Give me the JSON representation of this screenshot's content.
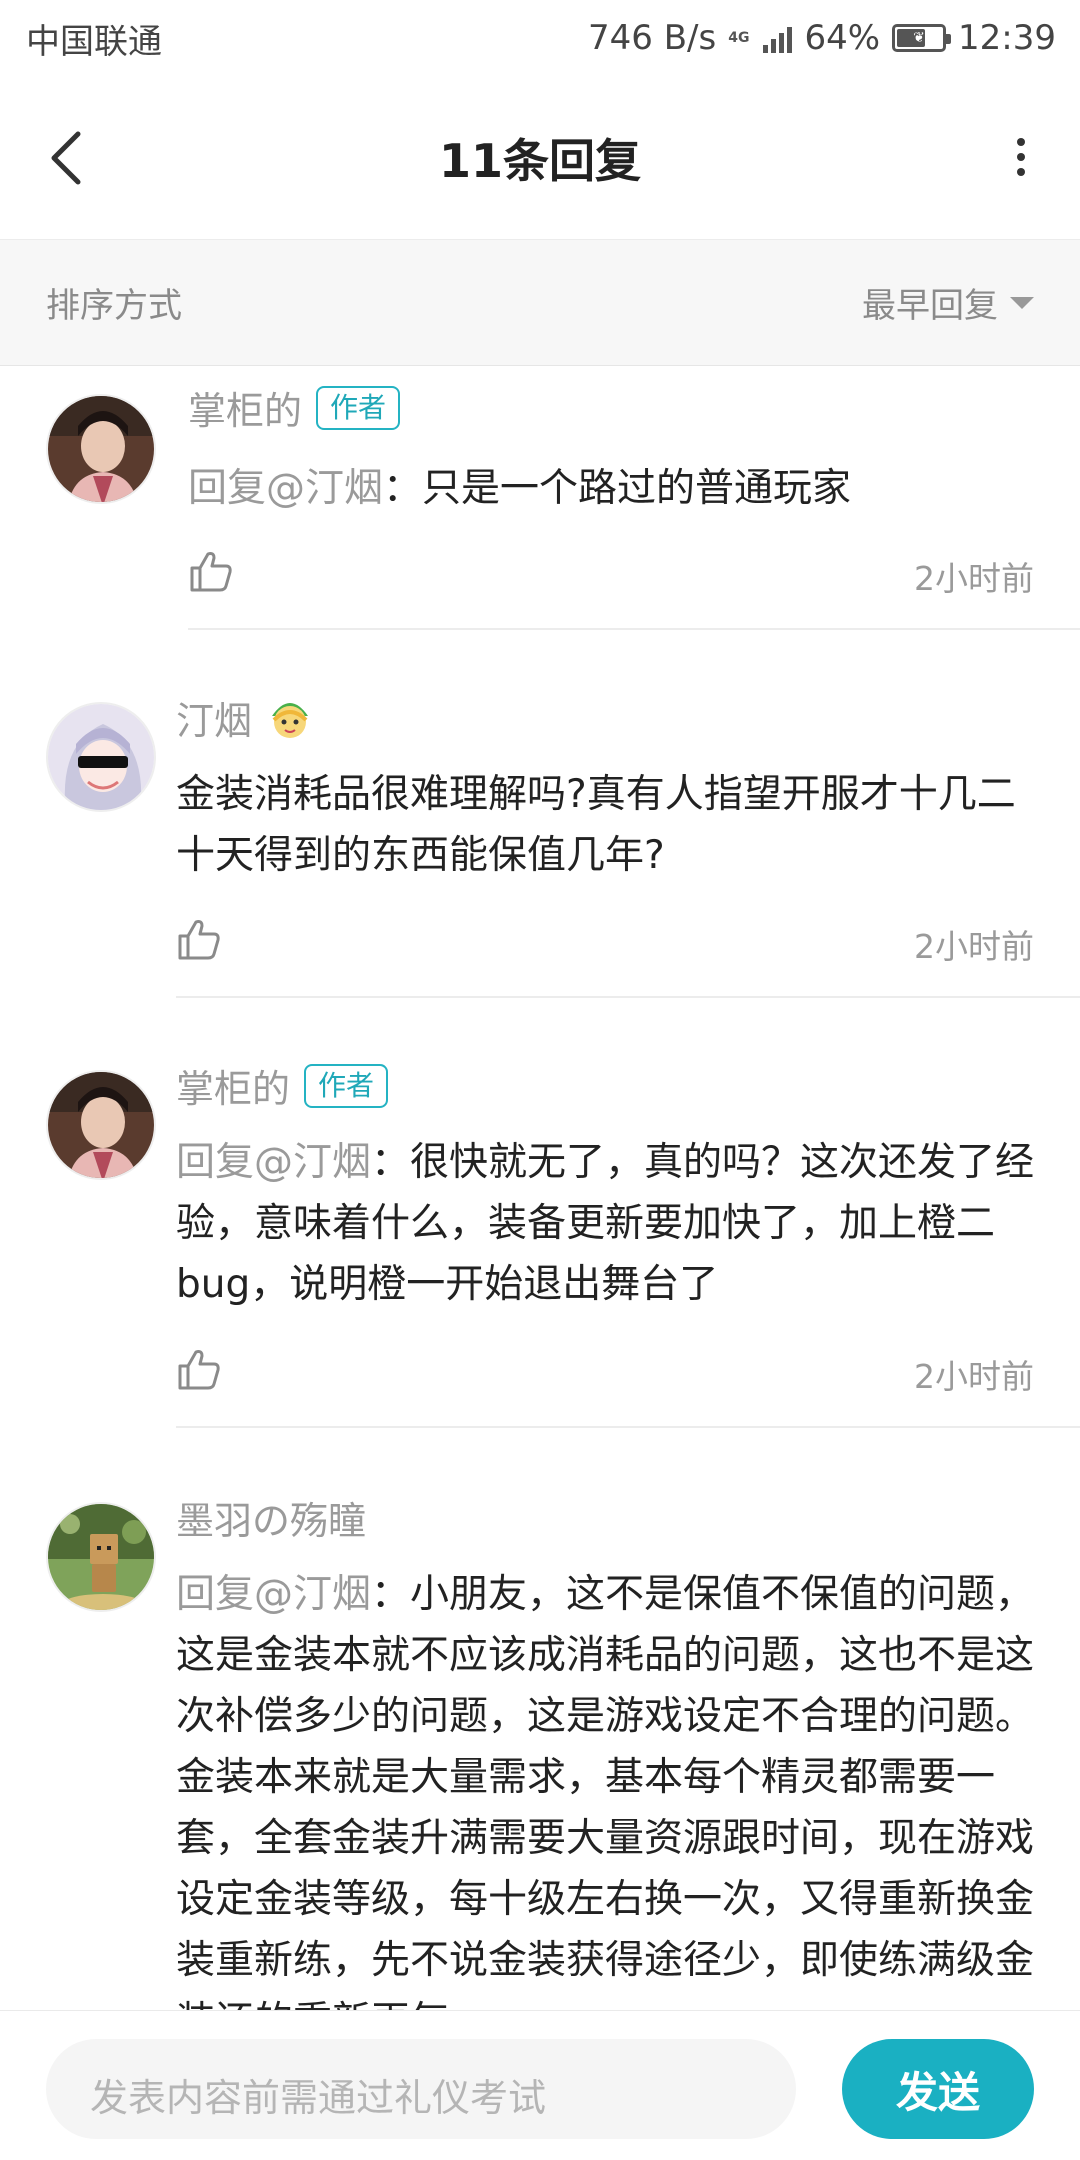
{
  "status_bar": {
    "carrier": "中国联通",
    "net_speed": "746 B/s",
    "net_type": "4G",
    "battery": "64%",
    "battery_level": 0.64,
    "time": "12:39"
  },
  "header": {
    "title": "11条回复"
  },
  "sort": {
    "label": "排序方式",
    "value": "最早回复"
  },
  "comments": [
    {
      "user": "掌柜的",
      "badge": "作者",
      "mention": "回复@汀烟",
      "text": "：只是一个路过的普通玩家",
      "time": "2小时前"
    },
    {
      "user": "汀烟",
      "badge_icon": "cartoon-face-icon",
      "text": "金装消耗品很难理解吗?真有人指望开服才十几二十天得到的东西能保值几年?",
      "time": "2小时前"
    },
    {
      "user": "掌柜的",
      "badge": "作者",
      "mention": "回复@汀烟",
      "text": "：很快就无了，真的吗？这次还发了经验，意味着什么，装备更新要加快了，加上橙二bug，说明橙一开始退出舞台了",
      "time": "2小时前"
    },
    {
      "user": "墨羽の殇瞳",
      "mention": "回复@汀烟",
      "text": "：小朋友，这不是保值不保值的问题，这是金装本就不应该成消耗品的问题，这也不是这次补偿多少的问题，这是游戏设定不合理的问题。金装本来就是大量需求，基本每个精灵都需要一套，全套金装升满需要大量资源跟时间，现在游戏设定金装等级，每十级左右换一次，又得重新换金装重新练，先不说金装获得途径少，即使练满级金装还的重新再气"
    }
  ],
  "composer": {
    "placeholder": "发表内容前需通过礼仪考试",
    "send_label": "发送"
  },
  "colors": {
    "accent": "#1ab0c2",
    "muted_text": "#9a9a9a"
  }
}
